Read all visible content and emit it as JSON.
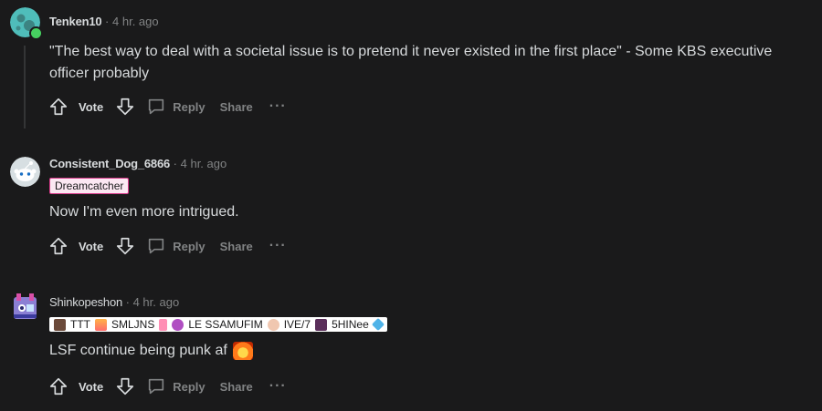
{
  "comments": [
    {
      "author": "Tenken10",
      "separator": "·",
      "timestamp": "4 hr. ago",
      "flair": null,
      "body": "\"The best way to deal with a societal issue is to pretend it never existed in the first place\" - Some KBS executive officer probably",
      "online": true
    },
    {
      "author": "Consistent_Dog_6866",
      "separator": "·",
      "timestamp": "4 hr. ago",
      "flair": "Dreamcatcher",
      "body": "Now I'm even more intrigued."
    },
    {
      "author": "Shinkopeshon",
      "separator": "·",
      "timestamp": "4 hr. ago",
      "flair_parts": [
        "TTT",
        "SMLJNS",
        "LE SSAMUFIM",
        "IVE/7",
        "5HINee"
      ],
      "body": "LSF continue being punk af"
    }
  ],
  "actions": {
    "vote_label": "Vote",
    "reply_label": "Reply",
    "share_label": "Share",
    "more_label": "···"
  },
  "colors": {
    "background": "#1a1a1b",
    "text": "#d7dadc",
    "muted": "#818384",
    "flair_bg": "#fce8f3",
    "online": "#46d160"
  },
  "icons": [
    "upvote-icon",
    "downvote-icon",
    "comment-bubble-icon",
    "more-icon",
    "fire-emoji-icon"
  ]
}
